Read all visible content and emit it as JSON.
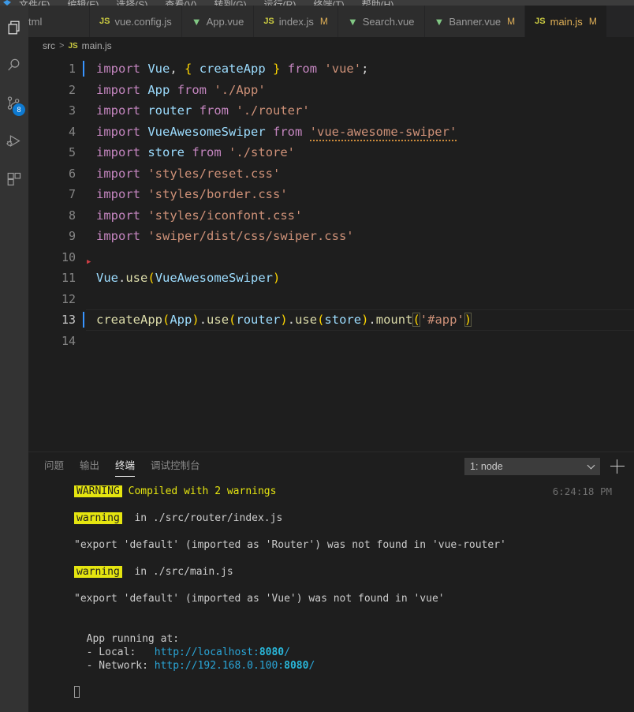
{
  "menubar": {
    "items": [
      "文件(F)",
      "编辑(E)",
      "选择(S)",
      "查看(V)",
      "转到(G)",
      "运行(R)",
      "终端(T)",
      "帮助(H)"
    ]
  },
  "activitybar": {
    "items": [
      {
        "name": "explorer",
        "icon": "files-icon",
        "badge": ""
      },
      {
        "name": "search",
        "icon": "search-icon",
        "badge": ""
      },
      {
        "name": "source-control",
        "icon": "source-control-icon",
        "badge": "8"
      },
      {
        "name": "run-debug",
        "icon": "run-debug-icon",
        "badge": ""
      },
      {
        "name": "extensions",
        "icon": "extensions-icon",
        "badge": ""
      }
    ]
  },
  "tabs": [
    {
      "label": "tml",
      "icon": "html",
      "modified": "",
      "active": false
    },
    {
      "label": "vue.config.js",
      "icon": "js",
      "modified": "",
      "active": false
    },
    {
      "label": "App.vue",
      "icon": "vue",
      "modified": "",
      "active": false
    },
    {
      "label": "index.js",
      "icon": "js",
      "modified": "M",
      "active": false
    },
    {
      "label": "Search.vue",
      "icon": "vue",
      "modified": "",
      "active": false
    },
    {
      "label": "Banner.vue",
      "icon": "vue",
      "modified": "M",
      "active": false
    },
    {
      "label": "main.js",
      "icon": "js",
      "modified": "M",
      "active": true
    }
  ],
  "breadcrumb": {
    "folder": "src",
    "separator": ">",
    "file_icon": "JS",
    "file": "main.js"
  },
  "editor": {
    "language": "javascript",
    "active_line": 13,
    "lines": [
      {
        "n": "1",
        "text": "import Vue, { createApp } from 'vue';"
      },
      {
        "n": "2",
        "text": "import App from './App'"
      },
      {
        "n": "3",
        "text": "import router from './router'"
      },
      {
        "n": "4",
        "text": "import VueAwesomeSwiper from 'vue-awesome-swiper'"
      },
      {
        "n": "5",
        "text": "import store from './store'"
      },
      {
        "n": "6",
        "text": "import 'styles/reset.css'"
      },
      {
        "n": "7",
        "text": "import 'styles/border.css'"
      },
      {
        "n": "8",
        "text": "import 'styles/iconfont.css'"
      },
      {
        "n": "9",
        "text": "import 'swiper/dist/css/swiper.css'"
      },
      {
        "n": "10",
        "text": ""
      },
      {
        "n": "11",
        "text": "Vue.use(VueAwesomeSwiper)"
      },
      {
        "n": "12",
        "text": ""
      },
      {
        "n": "13",
        "text": "createApp(App).use(router).use(store).mount('#app')"
      },
      {
        "n": "14",
        "text": ""
      }
    ]
  },
  "panel": {
    "tabs": [
      {
        "label": "问题",
        "active": false
      },
      {
        "label": "输出",
        "active": false
      },
      {
        "label": "终端",
        "active": true
      },
      {
        "label": "调试控制台",
        "active": false
      }
    ],
    "terminal_select": "1: node",
    "new_terminal_label": "+",
    "timestamp": "6:24:18 PM",
    "output": [
      {
        "type": "warn-badge",
        "badge": "WARNING",
        "text": " Compiled with 2 warnings"
      },
      {
        "type": "blank"
      },
      {
        "type": "warn-badge",
        "badge": "warning",
        "text": "  in ./src/router/index.js"
      },
      {
        "type": "blank"
      },
      {
        "type": "plain",
        "text": "\"export 'default' (imported as 'Router') was not found in 'vue-router'"
      },
      {
        "type": "blank"
      },
      {
        "type": "warn-badge",
        "badge": "warning",
        "text": "  in ./src/main.js"
      },
      {
        "type": "blank"
      },
      {
        "type": "plain",
        "text": "\"export 'default' (imported as 'Vue') was not found in 'vue'"
      },
      {
        "type": "blank"
      },
      {
        "type": "blank"
      },
      {
        "type": "plain",
        "text": "  App running at:"
      },
      {
        "type": "url",
        "prefix": "  - Local:   ",
        "url": "http://localhost:",
        "port": "8080",
        "suffix": "/"
      },
      {
        "type": "url",
        "prefix": "  - Network: ",
        "url": "http://192.168.0.100:",
        "port": "8080",
        "suffix": "/"
      },
      {
        "type": "blank"
      },
      {
        "type": "cursor"
      }
    ]
  },
  "colors": {
    "editor_bg": "#1e1e1e",
    "tabbar_bg": "#252526",
    "activitybar_bg": "#333333",
    "accent_badge": "#0e7ad1",
    "warning_yellow": "#e5e510",
    "link_cyan": "#2aa6d8",
    "active_tab_fg": "#e0b057"
  }
}
